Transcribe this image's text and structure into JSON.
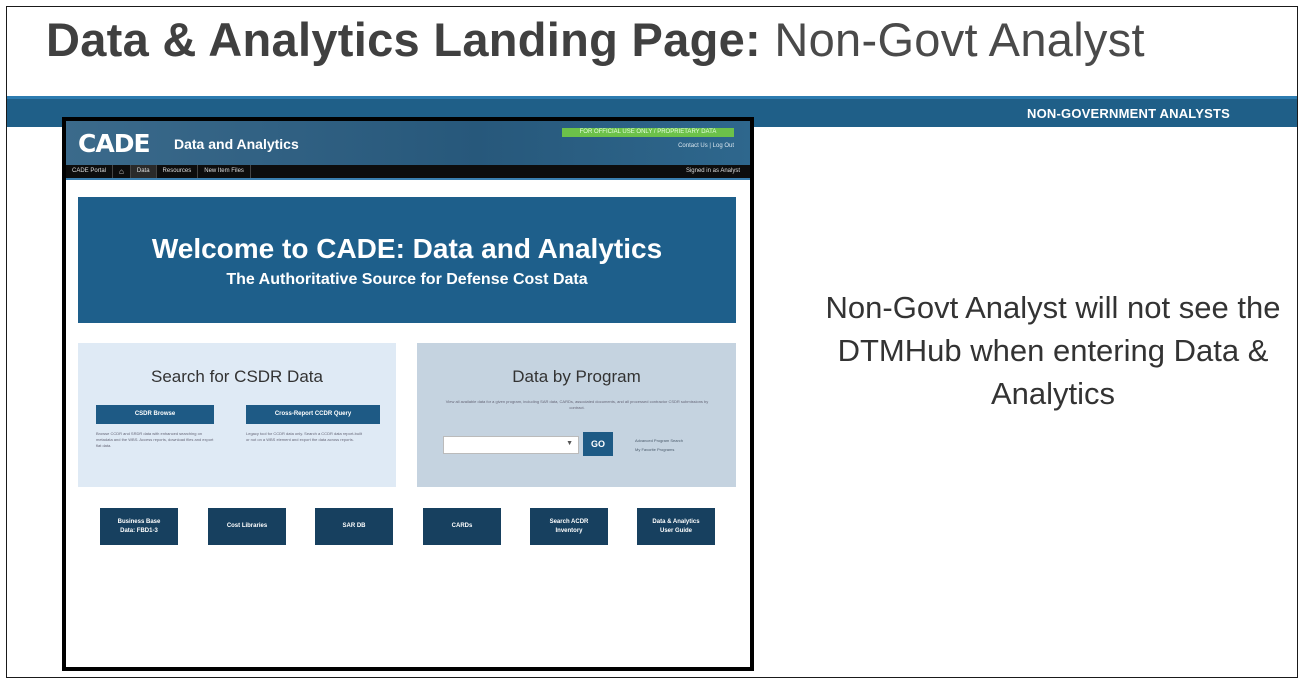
{
  "slide": {
    "title_bold": "Data & Analytics Landing Page:",
    "title_light": "Non-Govt Analyst",
    "band_label": "NON-GOVERNMENT ANALYSTS",
    "note": "Non-Govt Analyst will not see the DTMHub when entering Data & Analytics"
  },
  "app": {
    "logo": "CADE",
    "title": "Data and Analytics",
    "cui_banner": "FOR OFFICIAL USE ONLY / PROPRIETARY DATA",
    "top_links": "Contact Us | Log Out",
    "nav": [
      "CADE Portal",
      "Data",
      "Resources",
      "New Item Files"
    ],
    "signed_in": "Signed in as Analyst"
  },
  "welcome": {
    "heading": "Welcome to CADE: Data and Analytics",
    "subheading": "The Authoritative Source for Defense Cost Data"
  },
  "csdr": {
    "title": "Search for CSDR Data",
    "browse_button": "CSDR Browse",
    "query_button": "Cross-Report CCDR Query",
    "browse_desc": "Browse CCDR and SRDR data with enhanced searching on metadata and the WBS. Access reports, download files and export flat data.",
    "query_desc": "Legacy tool for CCDR data only. Search a CCDR data report-built or not on a WBS element and export the data across reports."
  },
  "program": {
    "title": "Data by Program",
    "desc": "View all available data for a given program, including SAR data, CARDs, associated documents, and all processed contractor CSDR submissions by contract.",
    "go_button": "GO",
    "link1": "Advanced Program Search",
    "link2": "My Favorite Programs"
  },
  "tiles": [
    "Business Base\nData: FBD1-3",
    "Cost Libraries",
    "SAR DB",
    "CARDs",
    "Search ACDR\nInventory",
    "Data & Analytics\nUser Guide"
  ]
}
